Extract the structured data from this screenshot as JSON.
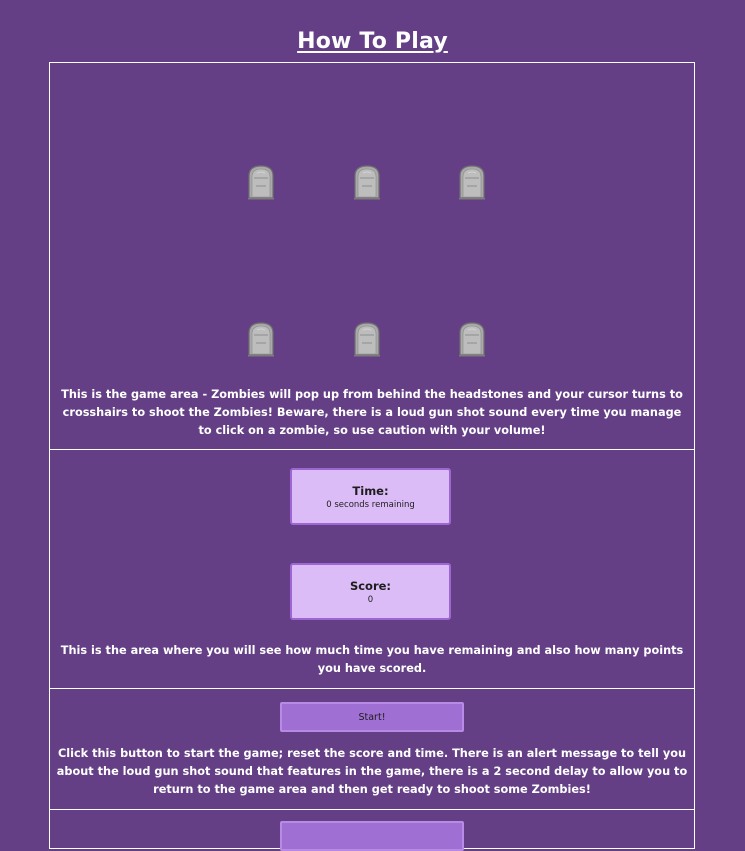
{
  "page": {
    "title": "How To Play"
  },
  "game_area": {
    "headstone_count": 6,
    "headstone_icon": "rip-headstone-icon",
    "description": "This is the game area - Zombies will pop up from behind the headstones and your cursor turns to crosshairs to shoot the Zombies! Beware, there is a loud gun shot sound every time you manage to click on a zombie, so use caution with your volume!"
  },
  "stats": {
    "time_label": "Time:",
    "time_value": "0 seconds remaining",
    "score_label": "Score:",
    "score_value": "0",
    "description": "This is the area where you will see how much time you have remaining and also how many points you have scored."
  },
  "start_section": {
    "button_label": "Start!",
    "description": "Click this button to start the game; reset the score and time. There is an alert message to tell you about the loud gun shot sound that features in the game, there is a 2 second delay to allow you to return to the game area and then get ready to shoot some Zombies!"
  },
  "colors": {
    "background": "#643f86",
    "panel_border": "#ffffff",
    "stat_box_fill": "#dbbcf7",
    "stat_box_border": "#9e66d2",
    "button_fill": "#a06fd4",
    "text": "#ffffff"
  }
}
